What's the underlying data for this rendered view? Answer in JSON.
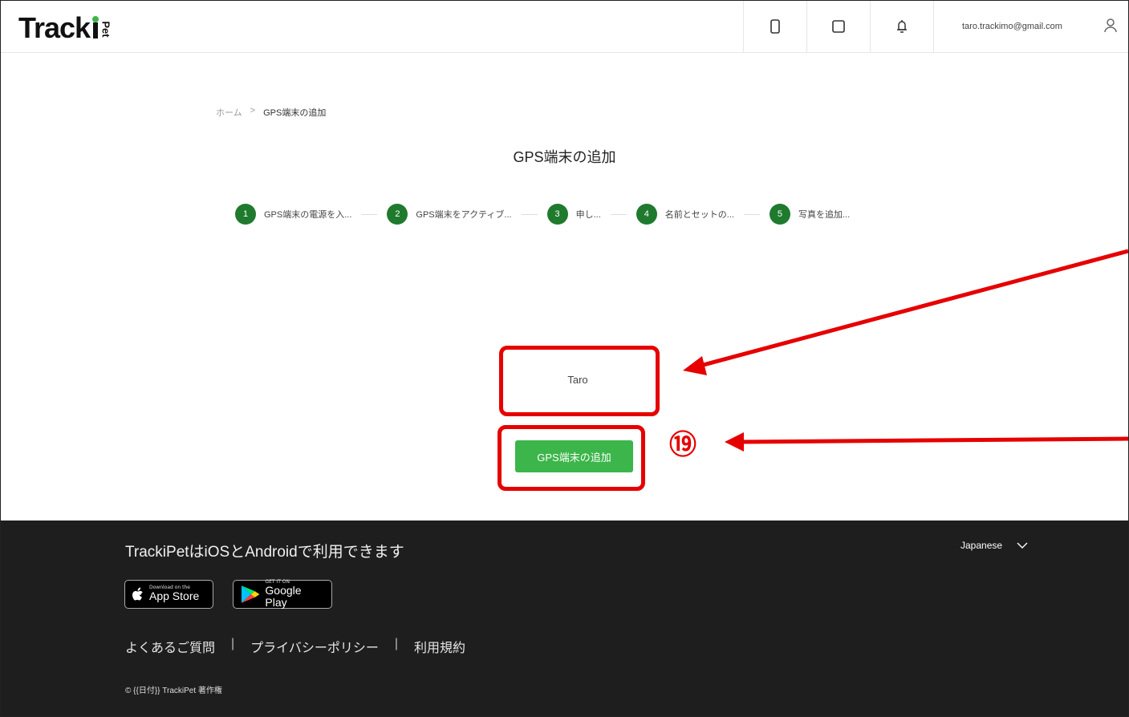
{
  "header": {
    "logo_text": "Track",
    "logo_pet": "Pet",
    "user_email": "taro.trackimo@gmail.com",
    "icons": [
      "phone-icon",
      "square-icon",
      "bell-icon",
      "user-icon"
    ]
  },
  "breadcrumb": {
    "home": "ホーム",
    "separator": ">",
    "current": "GPS端末の追加"
  },
  "page_title": "GPS端末の追加",
  "steps": [
    {
      "num": "1",
      "label": "GPS端末の電源を入..."
    },
    {
      "num": "2",
      "label": "GPS端末をアクティブ..."
    },
    {
      "num": "3",
      "label": "申し..."
    },
    {
      "num": "4",
      "label": "名前とセットの..."
    },
    {
      "num": "5",
      "label": "写真を追加..."
    }
  ],
  "name_value": "Taro",
  "add_button_label": "GPS端末の追加",
  "annotation_number": "⑲",
  "footer": {
    "availability": "TrackiPetはiOSとAndroidで利用できます",
    "language": "Japanese",
    "app_store_small": "Download on the",
    "app_store_big": "App Store",
    "google_play_small": "GET IT ON",
    "google_play_big": "Google Play",
    "links": {
      "faq": "よくあるご質問",
      "privacy": "プライバシーポリシー",
      "terms": "利用規約",
      "separator": "|"
    },
    "copyright": "© {{日付}} TrackiPet 著作権"
  },
  "colors": {
    "accent_green": "#3cb54a",
    "step_green": "#1f7a2e",
    "annotation_red": "#e60000",
    "footer_bg": "#1e1e1e"
  }
}
